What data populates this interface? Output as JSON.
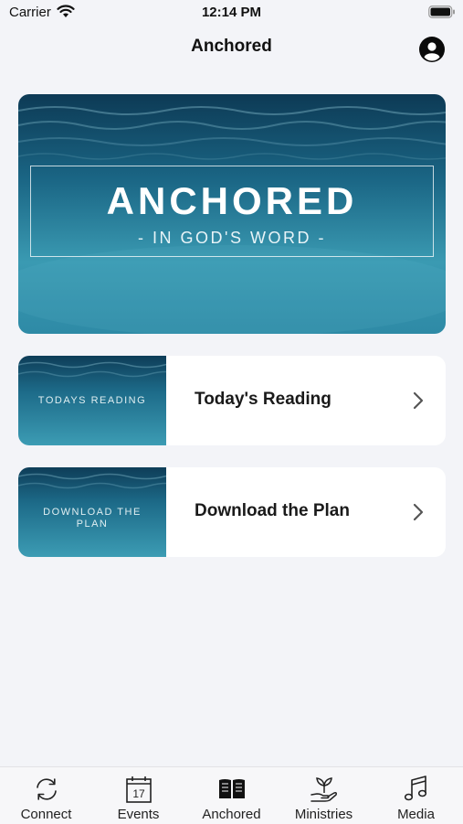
{
  "status_bar": {
    "carrier": "Carrier",
    "time": "12:14 PM",
    "icons": [
      "wifi-icon",
      "battery-icon"
    ]
  },
  "nav": {
    "title": "Anchored",
    "profile_icon": "user-icon"
  },
  "hero": {
    "title": "ANCHORED",
    "subtitle": "- IN GOD'S WORD -",
    "colors": {
      "dark": "#0c3e58",
      "mid": "#1b6f8e",
      "light": "#3f9fb5"
    }
  },
  "cards": [
    {
      "thumb_text": "TODAYS READING",
      "label": "Today's Reading",
      "icon": "chevron-right-icon"
    },
    {
      "thumb_text": "DOWNLOAD THE PLAN",
      "label": "Download the Plan",
      "icon": "chevron-right-icon"
    }
  ],
  "tabs": [
    {
      "label": "Connect",
      "icon": "sync-icon",
      "selected": false
    },
    {
      "label": "Events",
      "icon": "calendar-icon",
      "calendar_day": "17",
      "selected": false
    },
    {
      "label": "Anchored",
      "icon": "book-icon",
      "selected": true
    },
    {
      "label": "Ministries",
      "icon": "hand-plant-icon",
      "selected": false
    },
    {
      "label": "Media",
      "icon": "music-note-icon",
      "selected": false
    }
  ]
}
